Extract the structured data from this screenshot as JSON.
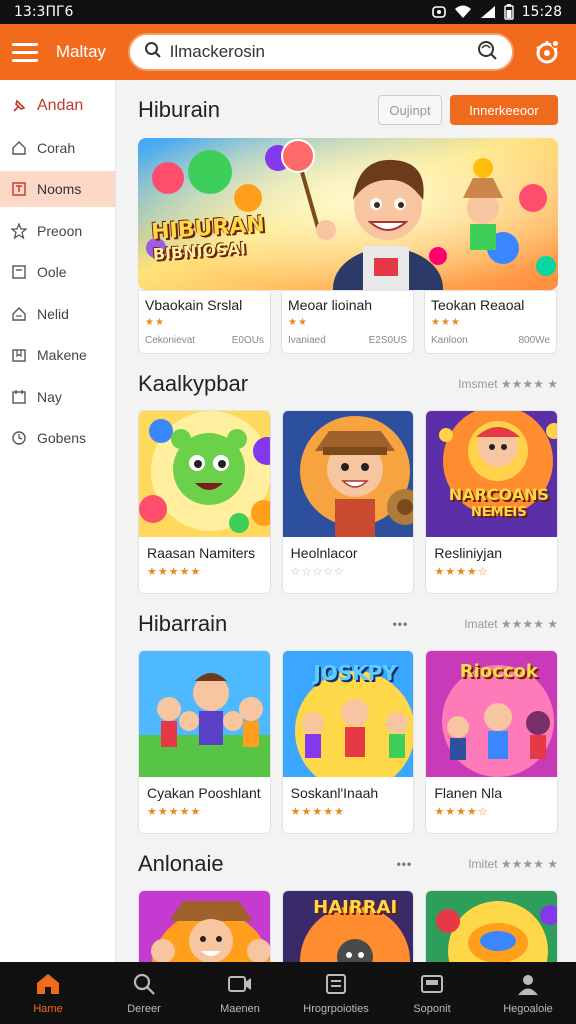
{
  "status": {
    "time": "13:3ПГ6",
    "time_right": "15:28"
  },
  "appbar": {
    "title": "Maltay",
    "search_value": "Ilmackerosin"
  },
  "sidebar": {
    "items": [
      {
        "label": "Andan",
        "icon": "pin-icon"
      },
      {
        "label": "Corah",
        "icon": "home-icon"
      },
      {
        "label": "Nooms",
        "icon": "document-icon"
      },
      {
        "label": "Preoon",
        "icon": "star-icon"
      },
      {
        "label": "Oole",
        "icon": "document-icon"
      },
      {
        "label": "Nelid",
        "icon": "home-icon"
      },
      {
        "label": "Makene",
        "icon": "bookmark-icon"
      },
      {
        "label": "Nay",
        "icon": "calendar-icon"
      },
      {
        "label": "Gobens",
        "icon": "clock-icon"
      }
    ]
  },
  "hero_section": {
    "title": "Hiburain",
    "btn_secondary": "Oujinpt",
    "btn_primary": "Innerkeeoor",
    "banner_line1": "HIBURAN",
    "banner_line2": "BIBNIOSAI",
    "cards": [
      {
        "name": "Vbaokain Srslal",
        "rating": "★★",
        "meta_left": "Cekonievat",
        "meta_right": "E0OUs"
      },
      {
        "name": "Meoar lioinah",
        "rating": "★★",
        "meta_left": "Ivaniaed",
        "meta_right": "E2S0US"
      },
      {
        "name": "Teokan Reaoal",
        "rating": "★★★",
        "meta_left": "Kanloon",
        "meta_right": "800We"
      }
    ]
  },
  "sections": [
    {
      "title": "Kaalkypbar",
      "more": "Imsmet ★★★★ ★",
      "cards": [
        {
          "name": "Raasan Namiters",
          "rating": "★★★★★",
          "art": "green"
        },
        {
          "name": "Heolnlacor",
          "rating": "☆☆☆☆☆",
          "art": "cowboy"
        },
        {
          "name": "Resliniyjan",
          "rating": "★★★★☆",
          "art": "logo",
          "art_text": "NARCOANS",
          "art_text2": "NEMEIS"
        }
      ]
    },
    {
      "title": "Hibarrain",
      "more": "Imatet ★★★★ ★",
      "cards": [
        {
          "name": "Cyakan Pooshlant",
          "rating": "★★★★★",
          "art": "group"
        },
        {
          "name": "Soskanl'Inaah",
          "rating": "★★★★★",
          "art": "logo2",
          "art_text": "JOSKPY"
        },
        {
          "name": "Flanen Nla",
          "rating": "★★★★☆",
          "art": "logo3",
          "art_text": "Rioccok"
        }
      ]
    },
    {
      "title": "Anlonaie",
      "more": "Imitet ★★★★ ★",
      "cards": [
        {
          "name": "",
          "rating": "",
          "art": "group2"
        },
        {
          "name": "",
          "rating": "",
          "art": "logo4",
          "art_text": "HAIRRAI"
        },
        {
          "name": "",
          "rating": "",
          "art": "orb"
        }
      ]
    }
  ],
  "bottomnav": {
    "items": [
      {
        "label": "Hame",
        "icon": "home-icon"
      },
      {
        "label": "Dereer",
        "icon": "search-icon"
      },
      {
        "label": "Maenen",
        "icon": "video-icon"
      },
      {
        "label": "Hrogrpoioties",
        "icon": "list-icon"
      },
      {
        "label": "Soponit",
        "icon": "gamepad-icon"
      },
      {
        "label": "Hegoaloie",
        "icon": "profile-icon"
      }
    ]
  },
  "colors": {
    "accent": "#f26b1d",
    "active_bg": "#fbd9c6",
    "nav_bg": "#111111",
    "stars": "#e58a1e"
  }
}
